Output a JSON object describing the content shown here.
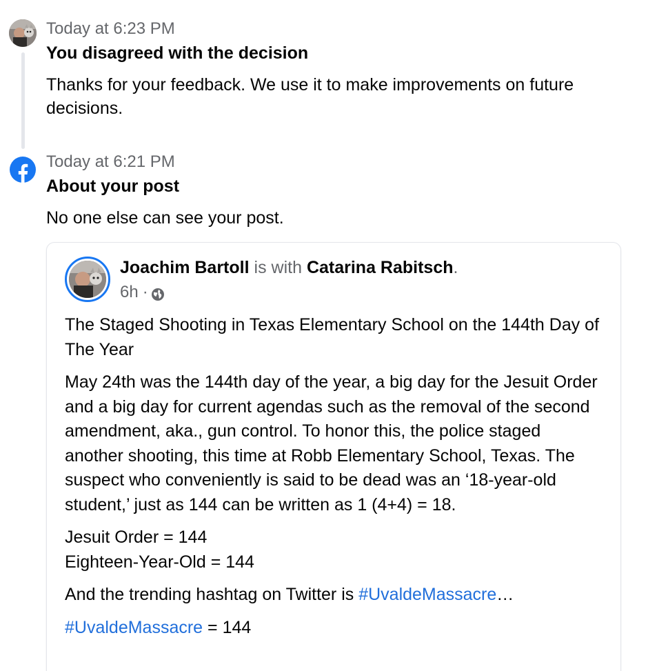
{
  "entries": [
    {
      "timestamp": "Today at 6:23 PM",
      "title": "You disagreed with the decision",
      "body": "Thanks for your feedback. We use it to make improvements on future decisions."
    },
    {
      "timestamp": "Today at 6:21 PM",
      "title": "About your post",
      "body": "No one else can see your post."
    }
  ],
  "post": {
    "author": "Joachim Bartoll",
    "with_text": "is with",
    "tagged": "Catarina Rabitsch",
    "period": ".",
    "time": "6h",
    "separator": "·",
    "paragraph1": "The Staged Shooting in Texas Elementary School on the 144th Day of The Year",
    "paragraph2": "May 24th was the 144th day of the year, a big day for the Jesuit Order and a big day for current agendas such as the removal of the second amendment, aka., gun control. To honor this, the police staged another shooting, this time at Robb Elementary School, Texas. The suspect who conveniently is said to be dead was an ‘18-year-old student,’ just as 144 can be written as 1 (4+4) = 18.",
    "line_jesuit": "Jesuit Order = 144",
    "line_eighteen": "Eighteen-Year-Old = 144",
    "trending_prefix": "And the trending hashtag on Twitter is ",
    "trending_hashtag": "#UvaldeMassacre",
    "trending_suffix": "…",
    "last_hashtag": "#UvaldeMassacre",
    "last_suffix": " = 144"
  },
  "colors": {
    "brand": "#1877f2",
    "link": "#216fdb",
    "secondary_text": "#65676b",
    "timeline": "#e4e6eb"
  },
  "icons": {
    "facebook": "facebook-logo-icon",
    "audience": "globe-icon"
  }
}
